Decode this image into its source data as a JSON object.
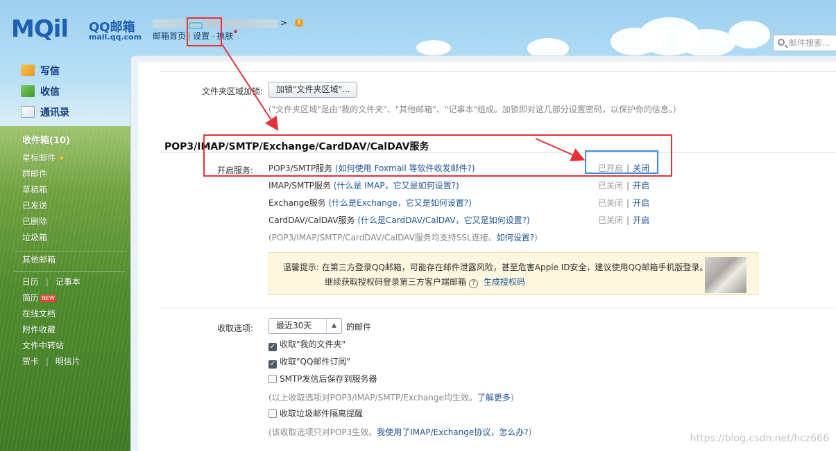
{
  "header": {
    "logo_letters": "MQil",
    "logo_name": "QQ邮箱",
    "logo_domain": "mail.qq.com",
    "user_suffix": ">",
    "links": [
      "邮箱首页",
      "设置",
      "换肤"
    ]
  },
  "search": {
    "placeholder": "邮件搜索..."
  },
  "sidebar": {
    "quick": [
      "写信",
      "收信",
      "通讯录"
    ],
    "folders": [
      "收件箱(10)",
      "星标邮件",
      "群邮件",
      "草稿箱",
      "已发送",
      "已删除",
      "垃圾箱"
    ],
    "other_mail": "其他邮箱",
    "apps": {
      "calendar": "日历",
      "notes": "记事本",
      "resume": "简历",
      "resume_badge": "NEW",
      "docs": "在线文档",
      "attachments": "附件收藏",
      "transfer": "文件中转站",
      "cards": "贺卡",
      "postcards": "明信片"
    }
  },
  "folder_lock": {
    "label": "文件夹区域加锁:",
    "button": "加锁\"文件夹区域\"...",
    "note": "(\"文件夹区域\"是由\"我的文件夹\"、\"其他邮箱\"、\"记事本\"组成。加锁即对这几部分设置密码，以保护你的信息。)"
  },
  "services": {
    "title": "POP3/IMAP/SMTP/Exchange/CardDAV/CalDAV服务",
    "label": "开启服务:",
    "rows": [
      {
        "name": "POP3/SMTP服务",
        "help": "(如何使用 Foxmail 等软件收发邮件?)",
        "state": "已开启",
        "action": "关闭"
      },
      {
        "name": "IMAP/SMTP服务",
        "help": "(什么是 IMAP，它又是如何设置?)",
        "state": "已关闭",
        "action": "开启"
      },
      {
        "name": "Exchange服务",
        "help": "(什么是Exchange，它又是如何设置?)",
        "state": "已关闭",
        "action": "开启"
      },
      {
        "name": "CardDAV/CalDAV服务",
        "help": "(什么是CardDAV/CalDAV，它又是如何设置?)",
        "state": "已关闭",
        "action": "开启"
      }
    ],
    "ssl_note": "(POP3/IMAP/SMTP/CardDAV/CalDAV服务均支持SSL连接。",
    "ssl_link": "如何设置?",
    "ssl_close": ")"
  },
  "tip": {
    "prefix": "温馨提示:",
    "line1": "在第三方登录QQ邮箱，可能存在邮件泄露风险，甚至危害Apple ID安全，建议使用QQ邮箱手机版登录。",
    "line2": "继续获取授权码登录第三方客户端邮箱",
    "help": "?",
    "link": "生成授权码"
  },
  "receive": {
    "label": "收取选项:",
    "select_value": "最近30天",
    "select_suffix": "的邮件",
    "options": [
      {
        "label": "收取\"我的文件夹\"",
        "checked": true
      },
      {
        "label": "收取\"QQ邮件订阅\"",
        "checked": true
      },
      {
        "label": "SMTP发信后保存到服务器",
        "checked": false
      }
    ],
    "note1": "(以上收取选项对POP3/IMAP/SMTP/Exchange均生效。",
    "note1_link": "了解更多",
    "note1_close": ")",
    "spam_option": {
      "label": "收取垃圾邮件隔离提醒",
      "checked": false
    },
    "note2": "(该收取选项只对POP3生效。",
    "note2_link": "我使用了IMAP/Exchange协议，怎么办?",
    "note2_close": ")"
  },
  "watermark": "https://blog.csdn.net/hcz666",
  "colors": {
    "accent": "#1e5494",
    "annotation_red": "#e5323a",
    "annotation_blue": "#3d8be0"
  }
}
